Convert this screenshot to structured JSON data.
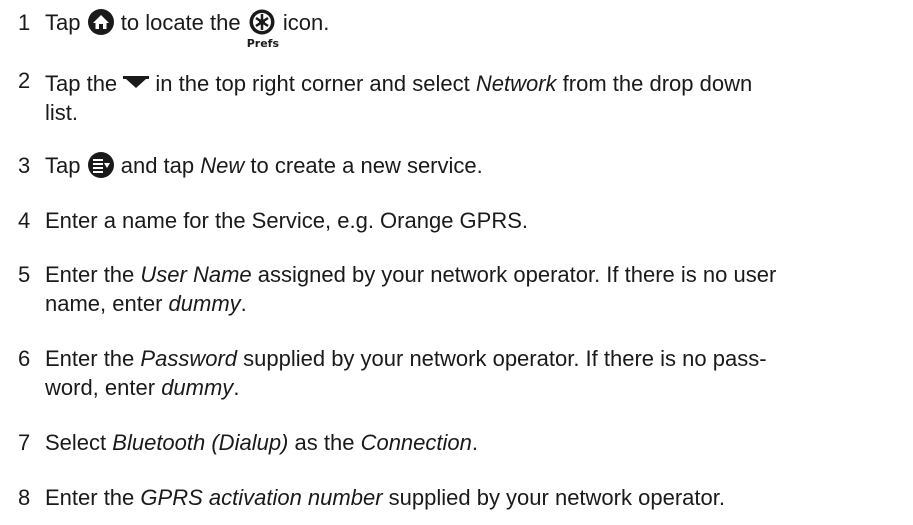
{
  "steps": [
    {
      "n": "1",
      "a": "Tap",
      "b": "to locate the",
      "c": "icon.",
      "prefs_label": "Prefs",
      "icons": [
        "home-icon",
        "prefs-icon"
      ]
    },
    {
      "n": "2",
      "a": "Tap the",
      "b": "in the top right corner and select",
      "em1": "Network",
      "c": "from the drop down",
      "line2": "list.",
      "icons": [
        "dropdown-arrow-icon"
      ]
    },
    {
      "n": "3",
      "a": "Tap",
      "b": "and tap",
      "em1": "New",
      "c": "to create a new service.",
      "icons": [
        "menu-icon"
      ]
    },
    {
      "n": "4",
      "a": "Enter a name for the Service, e.g. Orange GPRS."
    },
    {
      "n": "5",
      "a": "Enter the",
      "em1": "User Name",
      "b": "assigned by your network operator. If there is no user",
      "line2a": "name, enter",
      "em2": "dummy",
      "line2b": "."
    },
    {
      "n": "6",
      "a": "Enter the",
      "em1": "Password",
      "b": "supplied by your network operator. If there is no pass-",
      "line2a": "word, enter",
      "em2": "dummy",
      "line2b": "."
    },
    {
      "n": "7",
      "a": "Select",
      "em1": "Bluetooth (Dialup)",
      "b": "as the",
      "em2": "Connection",
      "c": "."
    },
    {
      "n": "8",
      "a": "Enter the",
      "em1": "GPRS activation number",
      "b": "supplied by your network operator."
    }
  ]
}
